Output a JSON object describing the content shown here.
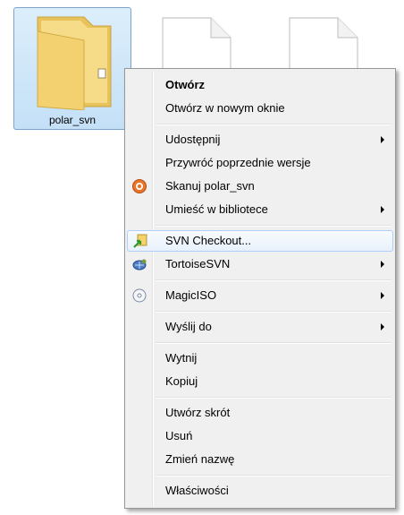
{
  "desktop": {
    "folder_name": "polar_svn"
  },
  "menu": {
    "items": [
      {
        "label": "Otwórz"
      },
      {
        "label": "Otwórz w nowym oknie"
      },
      {
        "label": "Udostępnij"
      },
      {
        "label": "Przywróć poprzednie wersje"
      },
      {
        "label": "Skanuj polar_svn"
      },
      {
        "label": "Umieść w bibliotece"
      },
      {
        "label": "SVN Checkout..."
      },
      {
        "label": "TortoiseSVN"
      },
      {
        "label": "MagicISO"
      },
      {
        "label": "Wyślij do"
      },
      {
        "label": "Wytnij"
      },
      {
        "label": "Kopiuj"
      },
      {
        "label": "Utwórz skrót"
      },
      {
        "label": "Usuń"
      },
      {
        "label": "Zmień nazwę"
      },
      {
        "label": "Właściwości"
      }
    ]
  }
}
